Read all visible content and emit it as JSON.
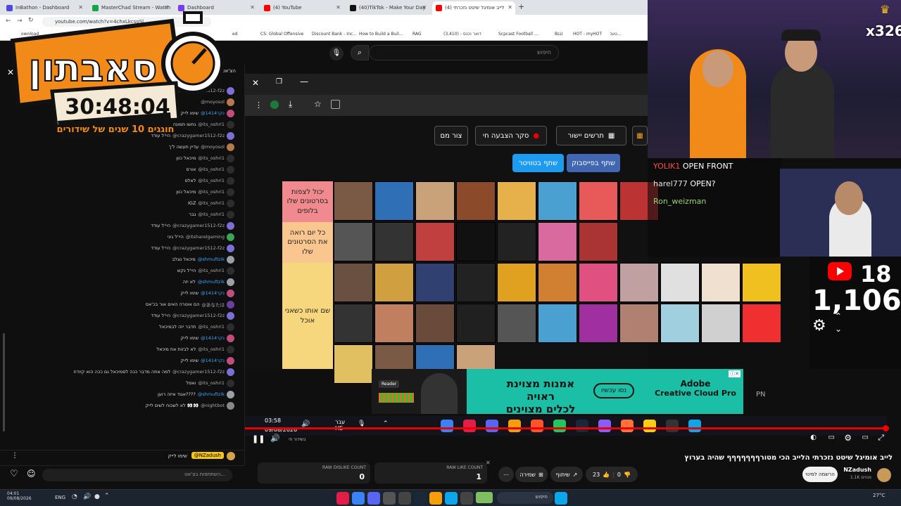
{
  "browser": {
    "tabs": [
      {
        "label": "InBathon - Dashboard",
        "color": "#4f46e5"
      },
      {
        "label": "MasterChad Stream - Watch L",
        "color": "#16a34a"
      },
      {
        "label": "Dashboard",
        "color": "#7c3aed"
      },
      {
        "label": "(4) YouTube",
        "color": "#ff0000"
      },
      {
        "label": "(40)TikTok - Make Your Day",
        "color": "#111111"
      },
      {
        "label": "(4) לייב אומיגל שיטט נזכרתי",
        "color": "#ff0000"
      }
    ],
    "url": "youtube.com/watch?v=4chxLkcsoSl",
    "bookmarks": [
      "ownload",
      "ed",
      "CS: Global Offensive",
      "Discount Bank - Inc...",
      "How to Build a Buil...",
      "RAG",
      "(3,410) - דואר נכנס",
      "Scpcast Football ...",
      "BLU",
      "HOT - myHOT",
      "טעכ..."
    ]
  },
  "youtube": {
    "search_placeholder": "חיפוש"
  },
  "logo": {
    "title": "סאבתון",
    "timer": "30:48:04",
    "subtitle": "חוגגים 10 שנים של שידורים"
  },
  "chat": {
    "header": "הצ'אט",
    "messages": [
      {
        "text": "עדיין תעשה ל'ך",
        "user": "@crazygamer1512-f2z",
        "blue": false,
        "color": "#7c6fd6"
      },
      {
        "text": "",
        "user": "@moyosol",
        "blue": false,
        "color": "#b8794b"
      },
      {
        "text": "שימו לייק",
        "user": "@1414נקר",
        "blue": true,
        "color": "#c04d7c"
      },
      {
        "text": "נחשו תמונה",
        "user": "@its_oshri1",
        "blue": false,
        "color": "#2d2d2d"
      },
      {
        "text": "היי'ל עודד",
        "user": "@crazygamer1512-f2z",
        "blue": false,
        "color": "#7c6fd6"
      },
      {
        "text": "עדיין תעשה ל'ך",
        "user": "@moyosol",
        "blue": false,
        "color": "#b8794b"
      },
      {
        "text": "מיכאל כוון",
        "user": "@its_oshri1",
        "blue": false,
        "color": "#2d2d2d"
      },
      {
        "text": "אורס",
        "user": "@its_oshri1",
        "blue": false,
        "color": "#2d2d2d"
      },
      {
        "text": "לאלס",
        "user": "@its_oshri1",
        "blue": false,
        "color": "#2d2d2d"
      },
      {
        "text": "מיכאל כוון",
        "user": "@its_oshri1",
        "blue": false,
        "color": "#2d2d2d"
      },
      {
        "text": "IGZ",
        "user": "@its_oshri1",
        "blue": false,
        "color": "#2d2d2d"
      },
      {
        "text": "גבר",
        "user": "@its_oshri1",
        "blue": false,
        "color": "#2d2d2d"
      },
      {
        "text": "היי'ל עודד",
        "user": "@crazygamer1512-f2z",
        "blue": false,
        "color": "#7c6fd6"
      },
      {
        "text": "היי'ל גיגי",
        "user": "@itsharelgaming",
        "blue": false,
        "color": "#3aa655"
      },
      {
        "text": "היי'ל עודד",
        "user": "@crazygamer1512-f2z",
        "blue": false,
        "color": "#7c6fd6"
      },
      {
        "text": "מיכאל נצלב",
        "user": "@shmuftzik",
        "blue": true,
        "color": "#9aa0a6"
      },
      {
        "text": "היי'ל נקש",
        "user": "@its_oshri1",
        "blue": false,
        "color": "#2d2d2d"
      },
      {
        "text": "לא יזה",
        "user": "@shmuftzik",
        "blue": true,
        "color": "#9aa0a6"
      },
      {
        "text": "שימו לייק",
        "user": "@1414נקר",
        "blue": true,
        "color": "#c04d7c"
      },
      {
        "text": "הם אוטרה האים אור בכ'אס",
        "user": "@あなたは",
        "blue": false,
        "color": "#6b3fa0"
      },
      {
        "text": "היי'ל עודד",
        "user": "@crazygamer1512-f2z",
        "blue": false,
        "color": "#7c6fd6"
      },
      {
        "text": "תדבר יזה לבמיכאל",
        "user": "@its_oshri1",
        "blue": false,
        "color": "#2d2d2d"
      },
      {
        "text": "שימו לייק",
        "user": "@1414נקר",
        "blue": true,
        "color": "#c04d7c"
      },
      {
        "text": "לא לבזות את מיכאל",
        "user": "@its_oshri1",
        "blue": false,
        "color": "#2d2d2d"
      },
      {
        "text": "שימו לייק",
        "user": "@1414נקר",
        "blue": true,
        "color": "#c04d7c"
      },
      {
        "text": "למה אתה מדבר ככה לסמיכאל גם ככה הוא קיודח",
        "user": "@crazygamer1512-f2z",
        "blue": false,
        "color": "#7c6fd6"
      },
      {
        "text": "ואסל",
        "user": "@its_oshri1",
        "blue": false,
        "color": "#2d2d2d"
      },
      {
        "text": "אגוד איזה רוען????",
        "user": "@shmuftzik",
        "blue": true,
        "color": "#9aa0a6"
      },
      {
        "text": "לא לשכוח לשים לייק 👀👀",
        "user": "@nightbot",
        "blue": false,
        "color": "#888888"
      }
    ],
    "pinned_user": "@NZadush",
    "pinned_text": "שימו לייק",
    "input_placeholder": "השתתפות בצ'אט..."
  },
  "overlay": {
    "chips": [
      {
        "label": "תרשים יישור",
        "icon": "grid-icon"
      },
      {
        "label": "סקר הצבעה חי",
        "icon": "record-icon"
      },
      {
        "label": "צור מם",
        "icon": ""
      }
    ],
    "share_facebook": "שתף בפייסבוק",
    "share_twitter": "שתף בטוויטר",
    "tiers": [
      {
        "label": "יכול לצפות בסרטונים שלו בלופים",
        "color": "#f08a8f"
      },
      {
        "label": "כל יום רואה את הסרטונים שלו",
        "color": "#f9c690"
      },
      {
        "label": "שם אותו כשאני אוכל",
        "color": "#f6d77d"
      }
    ]
  },
  "stream_chat": [
    {
      "user": "YOLIK1",
      "text": "OPEN FRONT",
      "color": "#ff4b4b"
    },
    {
      "user": "harel777",
      "text": "OPEN?",
      "color": "#e0e0e0"
    },
    {
      "user": "Ron_weizman",
      "text": "",
      "color": "#9ad17a"
    }
  ],
  "cam": {
    "sub_count": "x326",
    "viewers_top": "18",
    "viewers": "1,106"
  },
  "ad": {
    "headline": "אמנות מצוינת ראויה",
    "headline2": "לכלים מצוינים",
    "cta": "נסו עכשיו",
    "brand": "Adobe",
    "product": "Creative Cloud Pro",
    "badge": "Reader"
  },
  "player": {
    "time": "03:58",
    "date": "09/08/2026",
    "lang": "עבר",
    "lang2": "HE",
    "live_label": "בשידור חי"
  },
  "video": {
    "title": "לייב אומיגל שיטט נזכרתי הלייב הכי מטורףףףףףףף שהיה בערוץ",
    "channel": "NZadush",
    "subs": "1.1K מנויים",
    "subscribe": "הרשמה למינוי",
    "likes": "23",
    "dislikes": "0",
    "share": "שיתוף",
    "save": "שמירה",
    "raw_like_label": "RAW LIKE COUNT",
    "raw_like": "1",
    "raw_dislike_label": "RAW DISLIKE COUNT",
    "raw_dislike": "0"
  },
  "taskbar": {
    "time": "04:01",
    "date": "09/08/2026",
    "search": "חיפוש",
    "weather": "27°C",
    "lang": "ENG"
  }
}
